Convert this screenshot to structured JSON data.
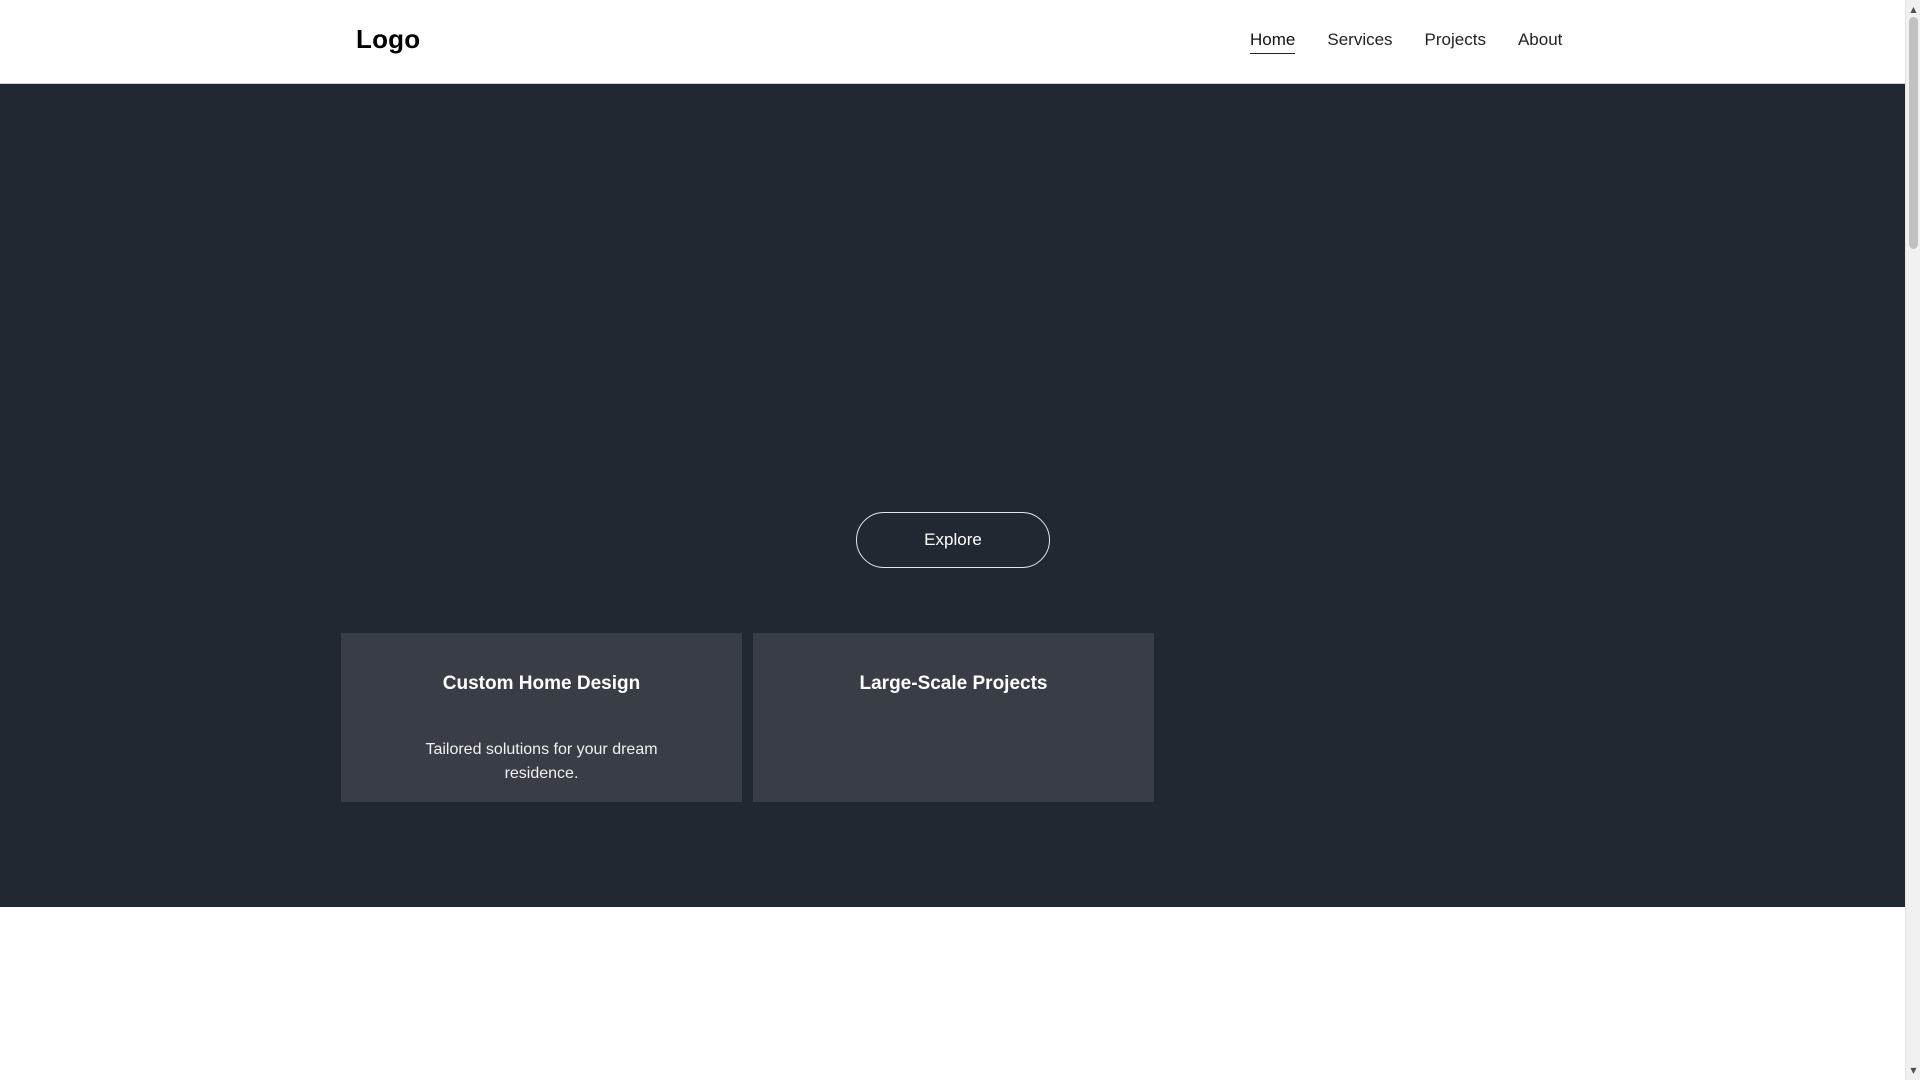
{
  "header": {
    "logo": "Logo",
    "nav": [
      {
        "label": "Home",
        "active": true
      },
      {
        "label": "Services",
        "active": false
      },
      {
        "label": "Projects",
        "active": false
      },
      {
        "label": "About",
        "active": false
      }
    ]
  },
  "hero": {
    "button_label": "Explore",
    "cards": [
      {
        "title": "Custom Home Design",
        "description": "Tailored solutions for your dream residence."
      },
      {
        "title": "Large-Scale Projects",
        "description": ""
      }
    ]
  },
  "colors": {
    "hero_background": "#222831",
    "card_background": "#393e46",
    "header_background": "#ffffff"
  },
  "icons": {
    "scroll_up": "scroll-up-arrow-icon",
    "scroll_down": "scroll-down-arrow-icon"
  }
}
